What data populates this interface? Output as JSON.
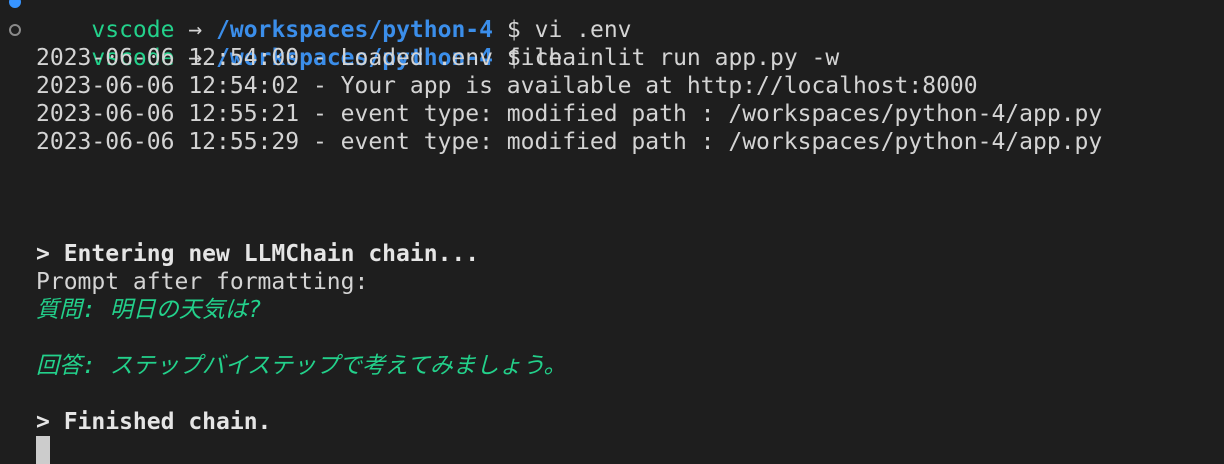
{
  "prompt": {
    "user": "vscode",
    "arrow": "→",
    "path": "/workspaces/python-4",
    "symbol": "$"
  },
  "commands": [
    "vi .env",
    "chainlit run app.py -w"
  ],
  "log_lines": [
    "2023-06-06 12:54:00 - Loaded .env file",
    "2023-06-06 12:54:02 - Your app is available at http://localhost:8000",
    "2023-06-06 12:55:21 - event type: modified path : /workspaces/python-4/app.py",
    "2023-06-06 12:55:29 - event type: modified path : /workspaces/python-4/app.py"
  ],
  "chain": {
    "entering": "> Entering new LLMChain chain...",
    "prompt_label": "Prompt after formatting:",
    "question": "質問: 明日の天気は?",
    "answer": "回答: ステップバイステップで考えてみましょう。",
    "finished": "> Finished chain."
  },
  "colors": {
    "background": "#1e1e1e",
    "prompt_green": "#23d18b",
    "path_blue": "#3b8eea",
    "gutter_dot_blue": "#3794ff"
  }
}
